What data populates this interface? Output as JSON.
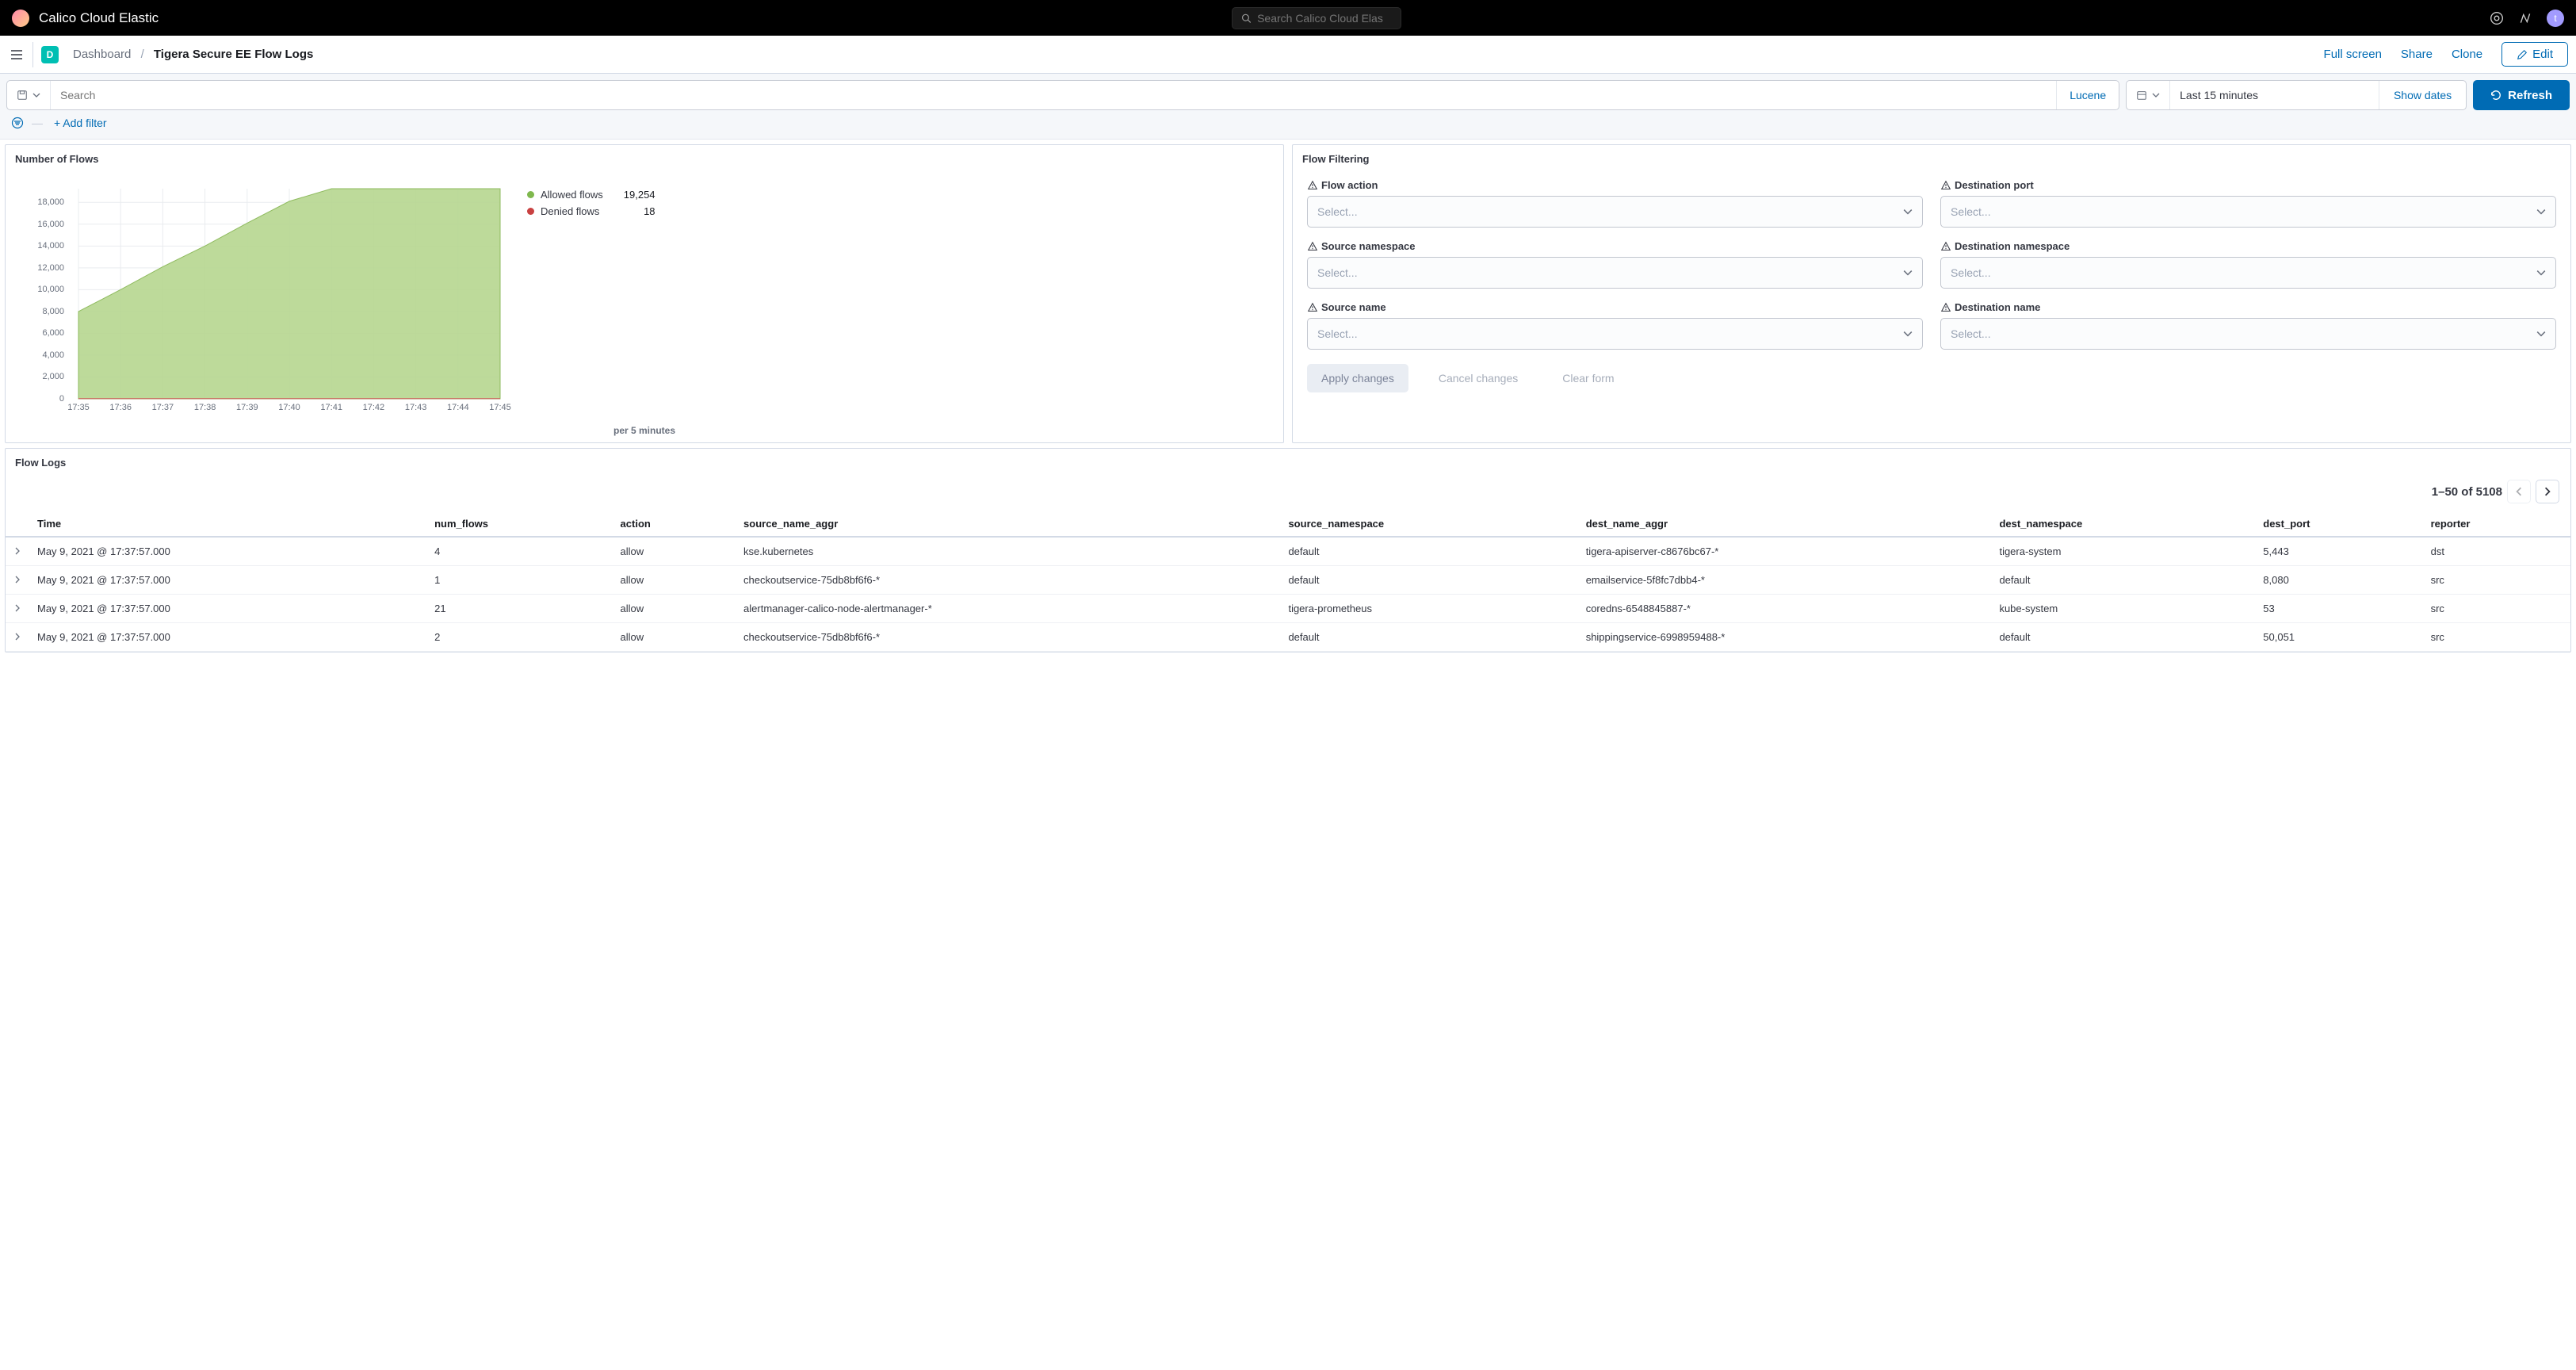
{
  "topbar": {
    "title": "Calico Cloud Elastic",
    "search_placeholder": "Search Calico Cloud Elas",
    "avatar_letter": "t"
  },
  "subheader": {
    "app_badge": "D",
    "breadcrumb_root": "Dashboard",
    "breadcrumb_current": "Tigera Secure EE Flow Logs",
    "links": {
      "fullscreen": "Full screen",
      "share": "Share",
      "clone": "Clone",
      "edit": "Edit"
    }
  },
  "querybar": {
    "search_placeholder": "Search",
    "lucene": "Lucene",
    "time_range": "Last 15 minutes",
    "show_dates": "Show dates",
    "refresh": "Refresh",
    "add_filter": "+ Add filter"
  },
  "flows_panel": {
    "title": "Number of Flows",
    "xlabel": "per 5 minutes",
    "legend": {
      "allowed_label": "Allowed flows",
      "allowed_value": "19,254",
      "denied_label": "Denied flows",
      "denied_value": "18"
    }
  },
  "chart_data": {
    "type": "area",
    "x": [
      "17:35",
      "17:36",
      "17:37",
      "17:38",
      "17:39",
      "17:40",
      "17:41",
      "17:42",
      "17:43",
      "17:44",
      "17:45"
    ],
    "series": [
      {
        "name": "Allowed flows",
        "color": "#a2cf7b",
        "values": [
          8000,
          10000,
          12100,
          14000,
          16100,
          18100,
          19254,
          19254,
          19254,
          19254,
          19254
        ]
      },
      {
        "name": "Denied flows",
        "color": "#c55",
        "values": [
          18,
          18,
          18,
          18,
          18,
          18,
          18,
          18,
          18,
          18,
          18
        ]
      }
    ],
    "ylim": [
      0,
      18000
    ],
    "yticks": [
      "0",
      "2,000",
      "4,000",
      "6,000",
      "8,000",
      "10,000",
      "12,000",
      "14,000",
      "16,000",
      "18,000"
    ],
    "xlabel": "per 5 minutes",
    "title": "Number of Flows"
  },
  "filter_panel": {
    "title": "Flow Filtering",
    "fields": {
      "flow_action": "Flow action",
      "dest_port": "Destination port",
      "src_ns": "Source namespace",
      "dest_ns": "Destination namespace",
      "src_name": "Source name",
      "dest_name": "Destination name"
    },
    "select_placeholder": "Select...",
    "apply": "Apply changes",
    "cancel": "Cancel changes",
    "clear": "Clear form"
  },
  "logs": {
    "title": "Flow Logs",
    "pager": "1–50 of 5108",
    "columns": [
      "Time",
      "num_flows",
      "action",
      "source_name_aggr",
      "source_namespace",
      "dest_name_aggr",
      "dest_namespace",
      "dest_port",
      "reporter"
    ],
    "rows": [
      [
        "May 9, 2021 @ 17:37:57.000",
        "4",
        "allow",
        "kse.kubernetes",
        "default",
        "tigera-apiserver-c8676bc67-*",
        "tigera-system",
        "5,443",
        "dst"
      ],
      [
        "May 9, 2021 @ 17:37:57.000",
        "1",
        "allow",
        "checkoutservice-75db8bf6f6-*",
        "default",
        "emailservice-5f8fc7dbb4-*",
        "default",
        "8,080",
        "src"
      ],
      [
        "May 9, 2021 @ 17:37:57.000",
        "21",
        "allow",
        "alertmanager-calico-node-alertmanager-*",
        "tigera-prometheus",
        "coredns-6548845887-*",
        "kube-system",
        "53",
        "src"
      ],
      [
        "May 9, 2021 @ 17:37:57.000",
        "2",
        "allow",
        "checkoutservice-75db8bf6f6-*",
        "default",
        "shippingservice-6998959488-*",
        "default",
        "50,051",
        "src"
      ]
    ]
  }
}
